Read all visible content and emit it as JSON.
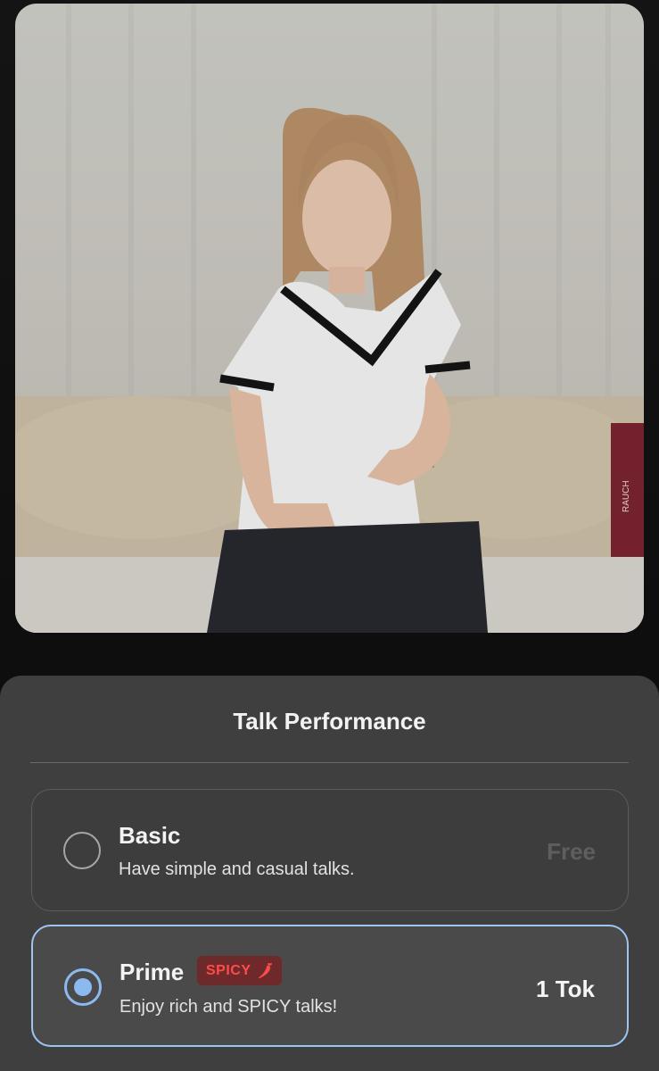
{
  "sheet": {
    "title": "Talk Performance",
    "options": [
      {
        "name": "Basic",
        "description": "Have simple and casual talks.",
        "price": "Free",
        "selected": false
      },
      {
        "name": "Prime",
        "badge": "SPICY",
        "badge_icon": "chili-pepper-icon",
        "description": "Enjoy rich and SPICY talks!",
        "price": "1 Tok",
        "selected": true
      }
    ]
  },
  "colors": {
    "accent": "#8cb9f0",
    "sheet_background": "#3f3f3f",
    "spicy_red": "#ff4b4b"
  },
  "video": {
    "book_spine_text": "RAUCH"
  }
}
